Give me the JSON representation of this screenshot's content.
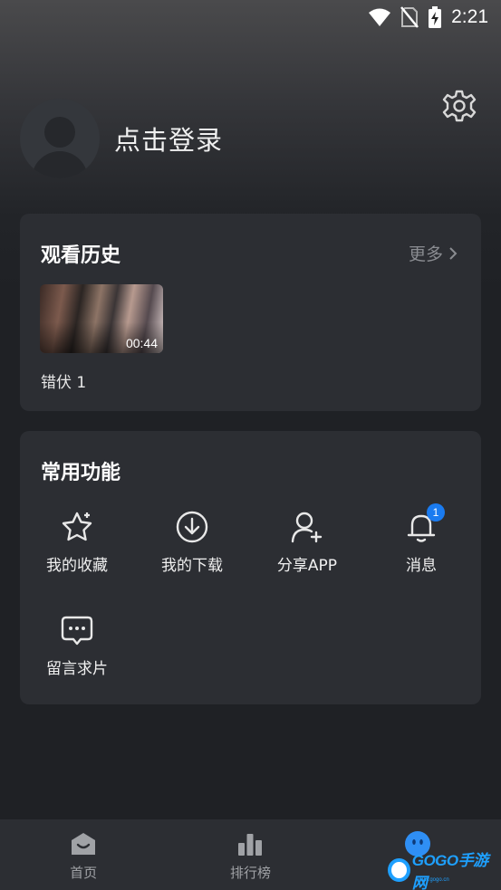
{
  "status_bar": {
    "time": "2:21"
  },
  "profile": {
    "login_text": "点击登录"
  },
  "history": {
    "title": "观看历史",
    "more_label": "更多",
    "items": [
      {
        "title": "错伏 1",
        "duration": "00:44"
      }
    ]
  },
  "functions": {
    "title": "常用功能",
    "items": [
      {
        "label": "我的收藏",
        "icon": "star-icon"
      },
      {
        "label": "我的下载",
        "icon": "download-icon"
      },
      {
        "label": "分享APP",
        "icon": "add-user-icon"
      },
      {
        "label": "消息",
        "icon": "bell-icon",
        "badge": "1"
      },
      {
        "label": "留言求片",
        "icon": "chat-icon"
      }
    ]
  },
  "tabbar": {
    "items": [
      {
        "label": "首页",
        "icon": "home-icon"
      },
      {
        "label": "排行榜",
        "icon": "bar-chart-icon"
      },
      {
        "label": "",
        "icon": "profile-face-icon",
        "active": true
      }
    ]
  },
  "watermark": {
    "text": "GOGO手游网",
    "sub": "www.gogo.cn"
  },
  "colors": {
    "badge": "#1a7bf0",
    "card": "#2c2e33",
    "background": "#1f2125",
    "accent": "#1ea0ff"
  }
}
